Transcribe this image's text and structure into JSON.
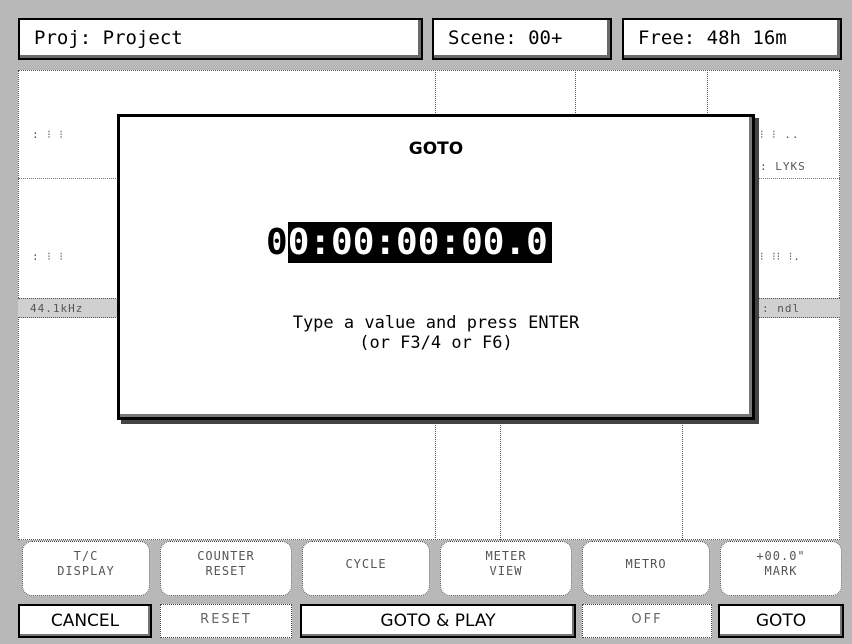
{
  "header": {
    "project_label": "Proj: Project",
    "scene_label": "Scene: 00+",
    "free_label": "Free: 48h 16m"
  },
  "background": {
    "row1_left": ": ⁝ ⁝",
    "row1_right": "⁝ ⁝ ..",
    "row1_right_sub": ": LYKS",
    "row2_left": ": ⁝ ⁝",
    "row2_right": "⁝ ⁝⁝ ⁝.",
    "bar_left": "44.1kHz",
    "bar_right": ": ndl"
  },
  "dialog": {
    "title": "GOTO",
    "timecode_cursor": "0",
    "timecode_rest": "0:00:00:00.0",
    "instruction_line1": "Type a value and press ENTER",
    "instruction_line2": "(or F3/4 or F6)"
  },
  "softkeys": [
    {
      "label": "T/C\nDISPLAY"
    },
    {
      "label": "COUNTER\nRESET"
    },
    {
      "label": "CYCLE"
    },
    {
      "label": "METER\nVIEW"
    },
    {
      "label": "METRO"
    },
    {
      "label": "+00.0\"\nMARK"
    }
  ],
  "function_keys": {
    "cancel": "CANCEL",
    "reset": "RESET",
    "goto_play": "GOTO & PLAY",
    "off": "OFF",
    "goto": "GOTO"
  }
}
